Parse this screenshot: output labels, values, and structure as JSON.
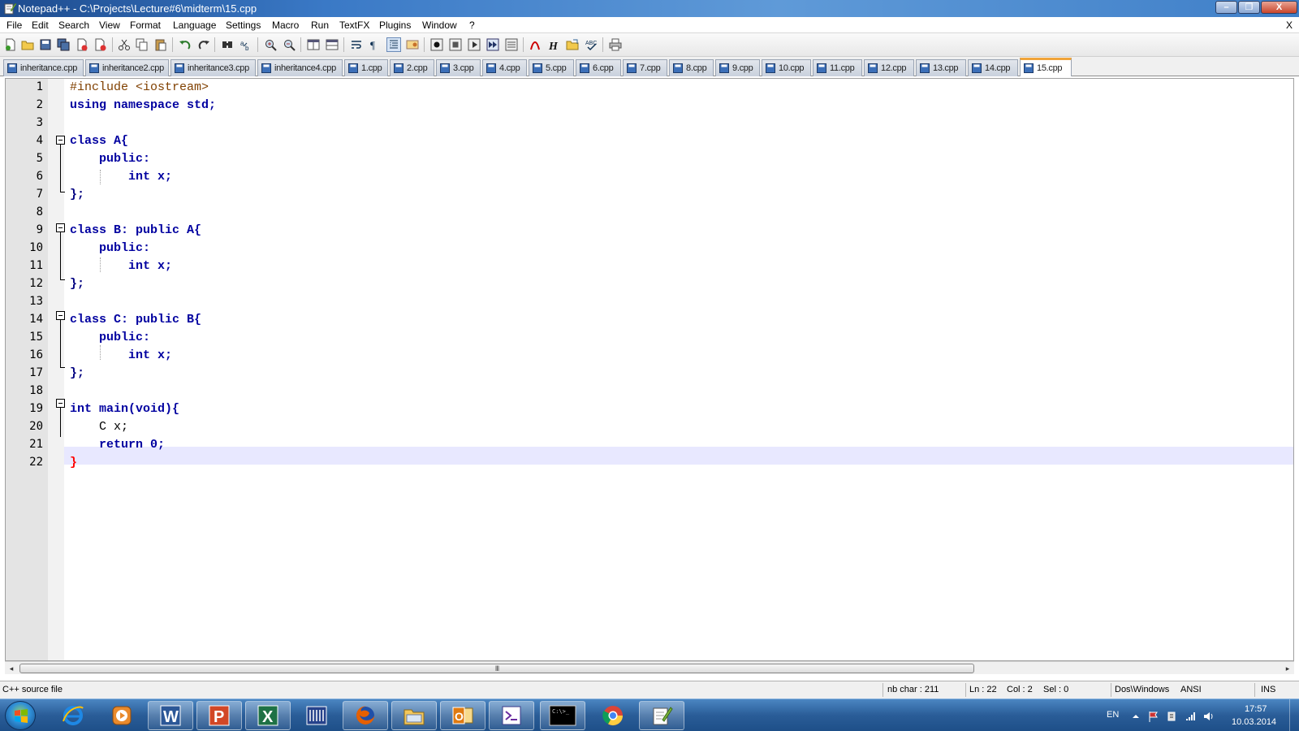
{
  "window": {
    "title": "Notepad++ - C:\\Projects\\Lecture#6\\midterm\\15.cpp",
    "minimize_glyph": "–",
    "maximize_glyph": "❐",
    "close_glyph": "X"
  },
  "menu": {
    "items": [
      "File",
      "Edit",
      "Search",
      "View",
      "Format",
      "Language",
      "Settings",
      "Macro",
      "Run",
      "TextFX",
      "Plugins",
      "Window",
      "?"
    ],
    "close_doc": "X"
  },
  "toolbar": {
    "icons": [
      "new-file-icon",
      "open-file-icon",
      "save-icon",
      "save-all-icon",
      "close-icon",
      "close-all-icon",
      "cut-icon",
      "copy-icon",
      "paste-icon",
      "undo-icon",
      "redo-icon",
      "find-icon",
      "replace-icon",
      "zoom-in-icon",
      "zoom-out-icon",
      "sync-vertical-icon",
      "sync-horizontal-icon",
      "word-wrap-icon",
      "show-all-chars-icon",
      "indent-guide-icon",
      "user-lang-icon",
      "record-macro-icon",
      "stop-macro-icon",
      "play-macro-icon",
      "run-macro-multiple-icon",
      "save-macro-icon",
      "pdf-icon",
      "h-icon",
      "folder-icon",
      "spellcheck-icon",
      "print-icon"
    ]
  },
  "tabs": {
    "items": [
      "inheritance.cpp",
      "inheritance2.cpp",
      "inheritance3.cpp",
      "inheritance4.cpp",
      "1.cpp",
      "2.cpp",
      "3.cpp",
      "4.cpp",
      "5.cpp",
      "6.cpp",
      "7.cpp",
      "8.cpp",
      "9.cpp",
      "10.cpp",
      "11.cpp",
      "12.cpp",
      "13.cpp",
      "14.cpp",
      "15.cpp"
    ],
    "active": "15.cpp"
  },
  "editor": {
    "line_numbers": [
      "1",
      "2",
      "3",
      "4",
      "5",
      "6",
      "7",
      "8",
      "9",
      "10",
      "11",
      "12",
      "13",
      "14",
      "15",
      "16",
      "17",
      "18",
      "19",
      "20",
      "21",
      "22"
    ],
    "lines": [
      "#include <iostream>",
      "using namespace std;",
      "",
      "class A{",
      "    public:",
      "        int x;",
      "};",
      "",
      "class B: public A{",
      "    public:",
      "        int x;",
      "};",
      "",
      "class C: public B{",
      "    public:",
      "        int x;",
      "};",
      "",
      "int main(void){",
      "    C x;",
      "    return 0;",
      "}"
    ],
    "current_line": 22
  },
  "scrollbar": {
    "grip": "III",
    "left_arrow": "◂",
    "right_arrow": "▸"
  },
  "status": {
    "file_type": "C++ source file",
    "nb_char": "nb char : 211",
    "ln": "Ln : 22",
    "col": "Col : 2",
    "sel": "Sel : 0",
    "eol": "Dos\\Windows",
    "encoding": "ANSI",
    "mode": "INS"
  },
  "taskbar": {
    "apps": [
      "internet-explorer-icon",
      "media-player-icon",
      "word-icon",
      "powerpoint-icon",
      "excel-icon",
      "app-grid-icon",
      "firefox-icon",
      "file-explorer-icon",
      "outlook-icon",
      "visual-studio-icon",
      "command-prompt-icon",
      "chrome-icon",
      "notepad-plus-icon"
    ],
    "language": "EN",
    "time": "17:57",
    "date": "10.03.2014"
  },
  "colors": {
    "keyword": "#0000a0",
    "number": "#ff8000",
    "current_line": "#e8e8ff",
    "active_tab_accent": "#f0a43a"
  }
}
